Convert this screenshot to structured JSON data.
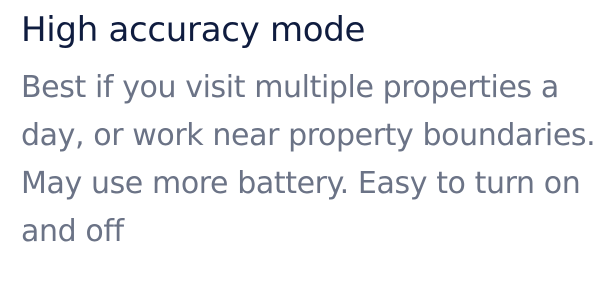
{
  "setting": {
    "title": "High accuracy mode",
    "description": "Best if you visit multiple properties a day, or work near property boundaries. May use more battery. Easy to turn on and off"
  },
  "colors": {
    "title": "#0f1c3f",
    "description": "#6b7386",
    "background": "#ffffff"
  }
}
